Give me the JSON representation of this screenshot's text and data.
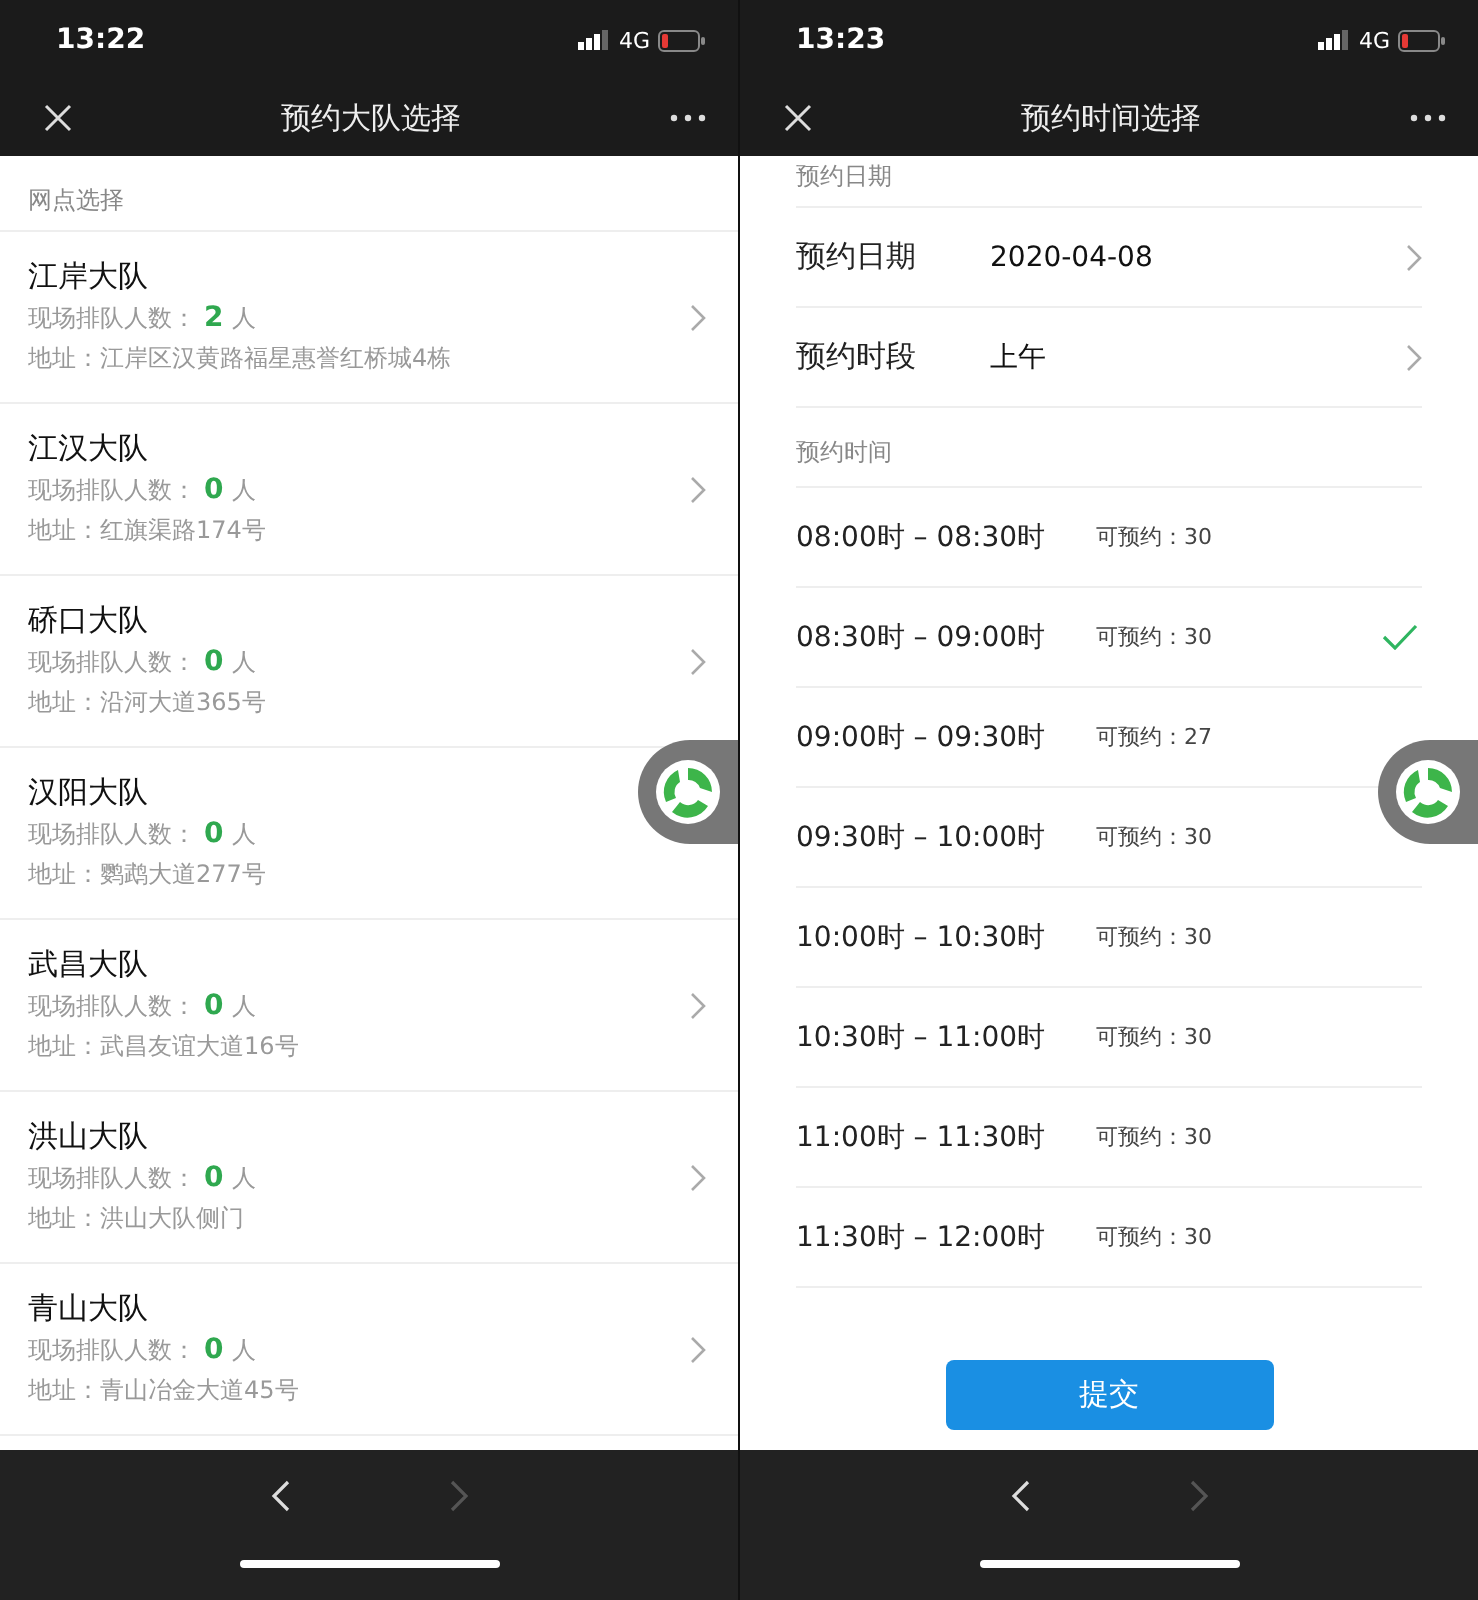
{
  "left": {
    "status_bar": {
      "time": "13:22",
      "network": "4G"
    },
    "title": "预约大队选择",
    "section_label": "网点选择",
    "stations": [
      {
        "name": "江岸大队",
        "queue_label": "现场排队人数：",
        "queue_count": "2",
        "queue_unit": "人",
        "address": "地址：江岸区汉黄路福星惠誉红桥城4栋",
        "chevron": true
      },
      {
        "name": "江汉大队",
        "queue_label": "现场排队人数：",
        "queue_count": "0",
        "queue_unit": "人",
        "address": "地址：红旗渠路174号",
        "chevron": true
      },
      {
        "name": "硚口大队",
        "queue_label": "现场排队人数：",
        "queue_count": "0",
        "queue_unit": "人",
        "address": "地址：沿河大道365号",
        "chevron": true
      },
      {
        "name": "汉阳大队",
        "queue_label": "现场排队人数：",
        "queue_count": "0",
        "queue_unit": "人",
        "address": "地址：鹦鹉大道277号",
        "chevron": false
      },
      {
        "name": "武昌大队",
        "queue_label": "现场排队人数：",
        "queue_count": "0",
        "queue_unit": "人",
        "address": "地址：武昌友谊大道16号",
        "chevron": true
      },
      {
        "name": "洪山大队",
        "queue_label": "现场排队人数：",
        "queue_count": "0",
        "queue_unit": "人",
        "address": "地址：洪山大队侧门",
        "chevron": true
      },
      {
        "name": "青山大队",
        "queue_label": "现场排队人数：",
        "queue_count": "0",
        "queue_unit": "人",
        "address": "地址：青山冶金大道45号",
        "chevron": true
      }
    ],
    "nav": {
      "back_disabled": false,
      "forward_disabled": true
    }
  },
  "right": {
    "status_bar": {
      "time": "13:23",
      "network": "4G"
    },
    "title": "预约时间选择",
    "date_section_label": "预约日期",
    "fields": [
      {
        "label": "预约日期",
        "value": "2020-04-08"
      },
      {
        "label": "预约时段",
        "value": "上午"
      }
    ],
    "time_section_label": "预约时间",
    "slots": [
      {
        "time": "08:00时 – 08:30时",
        "availability": "可预约：30",
        "selected": false
      },
      {
        "time": "08:30时 – 09:00时",
        "availability": "可预约：30",
        "selected": true
      },
      {
        "time": "09:00时 – 09:30时",
        "availability": "可预约：27",
        "selected": false
      },
      {
        "time": "09:30时 – 10:00时",
        "availability": "可预约：30",
        "selected": false
      },
      {
        "time": "10:00时 – 10:30时",
        "availability": "可预约：30",
        "selected": false
      },
      {
        "time": "10:30时 – 11:00时",
        "availability": "可预约：30",
        "selected": false
      },
      {
        "time": "11:00时 – 11:30时",
        "availability": "可预约：30",
        "selected": false
      },
      {
        "time": "11:30时 – 12:00时",
        "availability": "可预约：30",
        "selected": false
      }
    ],
    "submit": "提交",
    "nav": {
      "back_disabled": false,
      "forward_disabled": true
    }
  }
}
